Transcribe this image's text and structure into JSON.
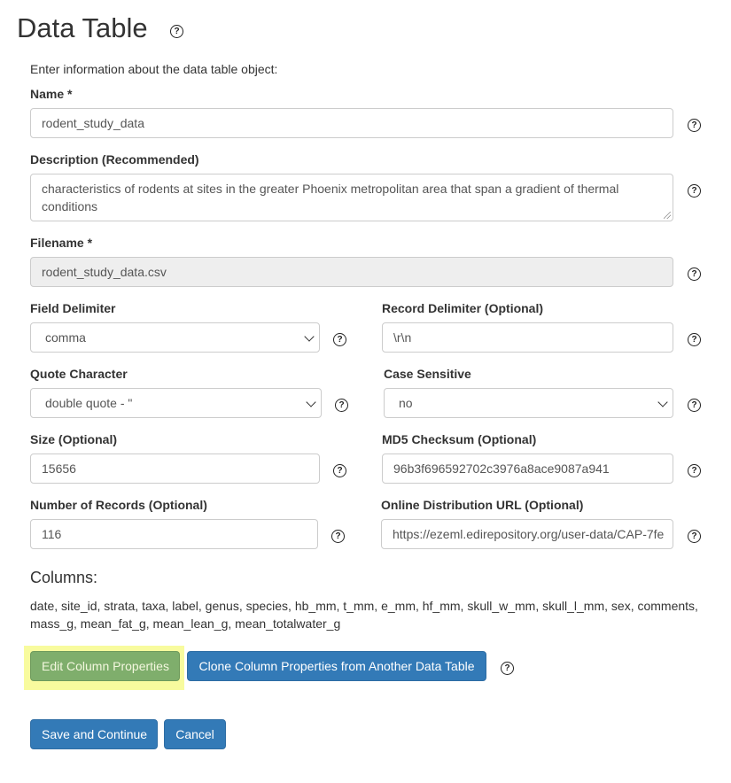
{
  "page": {
    "title": "Data Table",
    "intro": "Enter information about the data table object:",
    "help_glyph": "?"
  },
  "form": {
    "name": {
      "label": "Name *",
      "value": "rodent_study_data"
    },
    "description": {
      "label": "Description (Recommended)",
      "value": "characteristics of rodents at sites in the greater Phoenix metropolitan area that span a gradient of thermal conditions"
    },
    "filename": {
      "label": "Filename *",
      "value": "rodent_study_data.csv"
    },
    "field_delimiter": {
      "label": "Field Delimiter",
      "value": "comma"
    },
    "record_delimiter": {
      "label": "Record Delimiter (Optional)",
      "value": "\\r\\n"
    },
    "quote_character": {
      "label": "Quote Character",
      "value": "double quote - \""
    },
    "case_sensitive": {
      "label": "Case Sensitive",
      "value": "no"
    },
    "size": {
      "label": "Size (Optional)",
      "value": "15656"
    },
    "md5": {
      "label": "MD5 Checksum (Optional)",
      "value": "96b3f696592702c3976a8ace9087a941"
    },
    "num_records": {
      "label": "Number of Records (Optional)",
      "value": "116"
    },
    "online_url": {
      "label": "Online Distribution URL (Optional)",
      "value": "https://ezeml.edirepository.org/user-data/CAP-7fe"
    }
  },
  "columns": {
    "heading": "Columns:",
    "list": "date, site_id, strata, taxa, label, genus, species, hb_mm, t_mm, e_mm, hf_mm, skull_w_mm, skull_l_mm, sex, comments, mass_g, mean_fat_g, mean_lean_g, mean_totalwater_g"
  },
  "buttons": {
    "edit_columns": "Edit Column Properties",
    "clone_columns": "Clone Column Properties from Another Data Table",
    "save_continue": "Save and Continue",
    "cancel": "Cancel"
  },
  "colors": {
    "primary": "#337ab7",
    "edit_button": "#7fae6c",
    "highlight": "#f8fb9e",
    "disabled_field": "#eeeeee"
  },
  "icons": {
    "help": "question-circle-icon",
    "select_arrow": "chevron-down-icon",
    "resize": "textarea-resize-icon"
  }
}
